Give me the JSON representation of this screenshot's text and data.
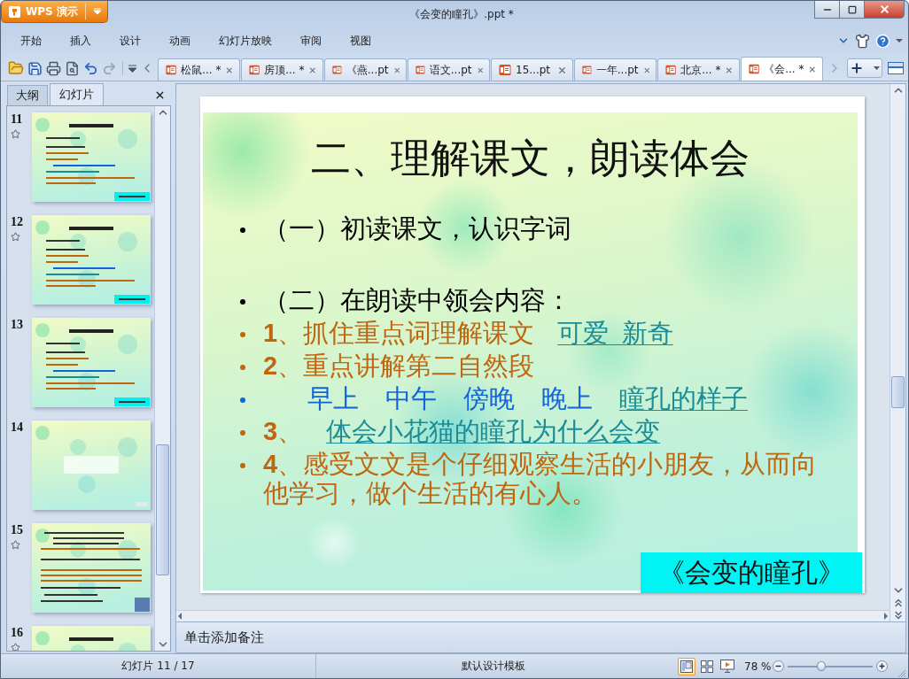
{
  "app_button": {
    "label": "WPS 演示"
  },
  "window": {
    "title": "《会变的瞳孔》.ppt *"
  },
  "menu": [
    "开始",
    "插入",
    "设计",
    "动画",
    "幻灯片放映",
    "审阅",
    "视图"
  ],
  "document_tabs": [
    {
      "label": "松鼠... *",
      "selected": false
    },
    {
      "label": "房顶... *",
      "selected": false
    },
    {
      "label": "《燕...pt",
      "selected": false
    },
    {
      "label": "语文...pt",
      "selected": false
    },
    {
      "label": "15...pt",
      "selected": false
    },
    {
      "label": "一年...pt",
      "selected": false
    },
    {
      "label": "北京... *",
      "selected": false
    },
    {
      "label": "《会... *",
      "selected": true
    }
  ],
  "side_panel": {
    "tabs": [
      {
        "label": "大纲",
        "selected": false
      },
      {
        "label": "幻灯片",
        "selected": true
      }
    ],
    "slides": [
      {
        "number": "11",
        "animated": true,
        "selected": false,
        "kind": "text"
      },
      {
        "number": "12",
        "animated": true,
        "selected": false,
        "kind": "text"
      },
      {
        "number": "13",
        "animated": false,
        "selected": false,
        "kind": "text"
      },
      {
        "number": "14",
        "animated": false,
        "selected": false,
        "kind": "closing"
      },
      {
        "number": "15",
        "animated": true,
        "selected": false,
        "kind": "photo"
      },
      {
        "number": "16",
        "animated": true,
        "selected": false,
        "kind": "text"
      }
    ]
  },
  "slide": {
    "title": "二、理解课文，朗读体会",
    "bullets": [
      {
        "kind": "text",
        "color": "#000000",
        "runs": [
          {
            "text": "（一）初读课文，认识字词",
            "kind": "plain"
          }
        ]
      },
      {
        "kind": "text",
        "color": "#000000",
        "runs": [
          {
            "text": "（二）在朗读中领会内容：",
            "kind": "plain"
          }
        ]
      },
      {
        "kind": "text",
        "color": "#c0660e",
        "runs": [
          {
            "text": "**1**、抓住重点词理解课文",
            "kind": "plain"
          },
          {
            "text": "可爱  新奇",
            "kind": "link"
          }
        ]
      },
      {
        "kind": "text",
        "color": "#c0660e",
        "runs": [
          {
            "text": "**2**、重点讲解第二自然段",
            "kind": "plain"
          }
        ]
      },
      {
        "kind": "terms",
        "color": "#1064d8",
        "runs": [
          {
            "text": "早上",
            "kind": "plain"
          },
          {
            "text": "中午",
            "kind": "plain"
          },
          {
            "text": "傍晚",
            "kind": "plain"
          },
          {
            "text": "晚上",
            "kind": "plain"
          },
          {
            "text": "瞳孔的样子",
            "kind": "link"
          }
        ]
      },
      {
        "kind": "text",
        "color": "#c0660e",
        "runs": [
          {
            "text": "**3**、",
            "kind": "plain"
          },
          {
            "text": "体会小花猫的瞳孔为什么会变",
            "kind": "link"
          }
        ]
      },
      {
        "kind": "text",
        "color": "#c0660e",
        "runs": [
          {
            "text": "**4**、感受文文是个仔细观察生活的小朋友，从而向他学习，做个生活的有心人。",
            "kind": "plain"
          }
        ]
      }
    ],
    "footer": "《会变的瞳孔》"
  },
  "notes": {
    "placeholder": "单击添加备注"
  },
  "status_bar": {
    "slide_counter": "幻灯片 11 / 17",
    "template": "默认设计模板",
    "views": [
      {
        "kind": "normal",
        "selected": true
      },
      {
        "kind": "sorter",
        "selected": false
      },
      {
        "kind": "show",
        "selected": false
      }
    ],
    "zoom": "78 %",
    "zoom_slider": {
      "level": 0.4
    }
  }
}
